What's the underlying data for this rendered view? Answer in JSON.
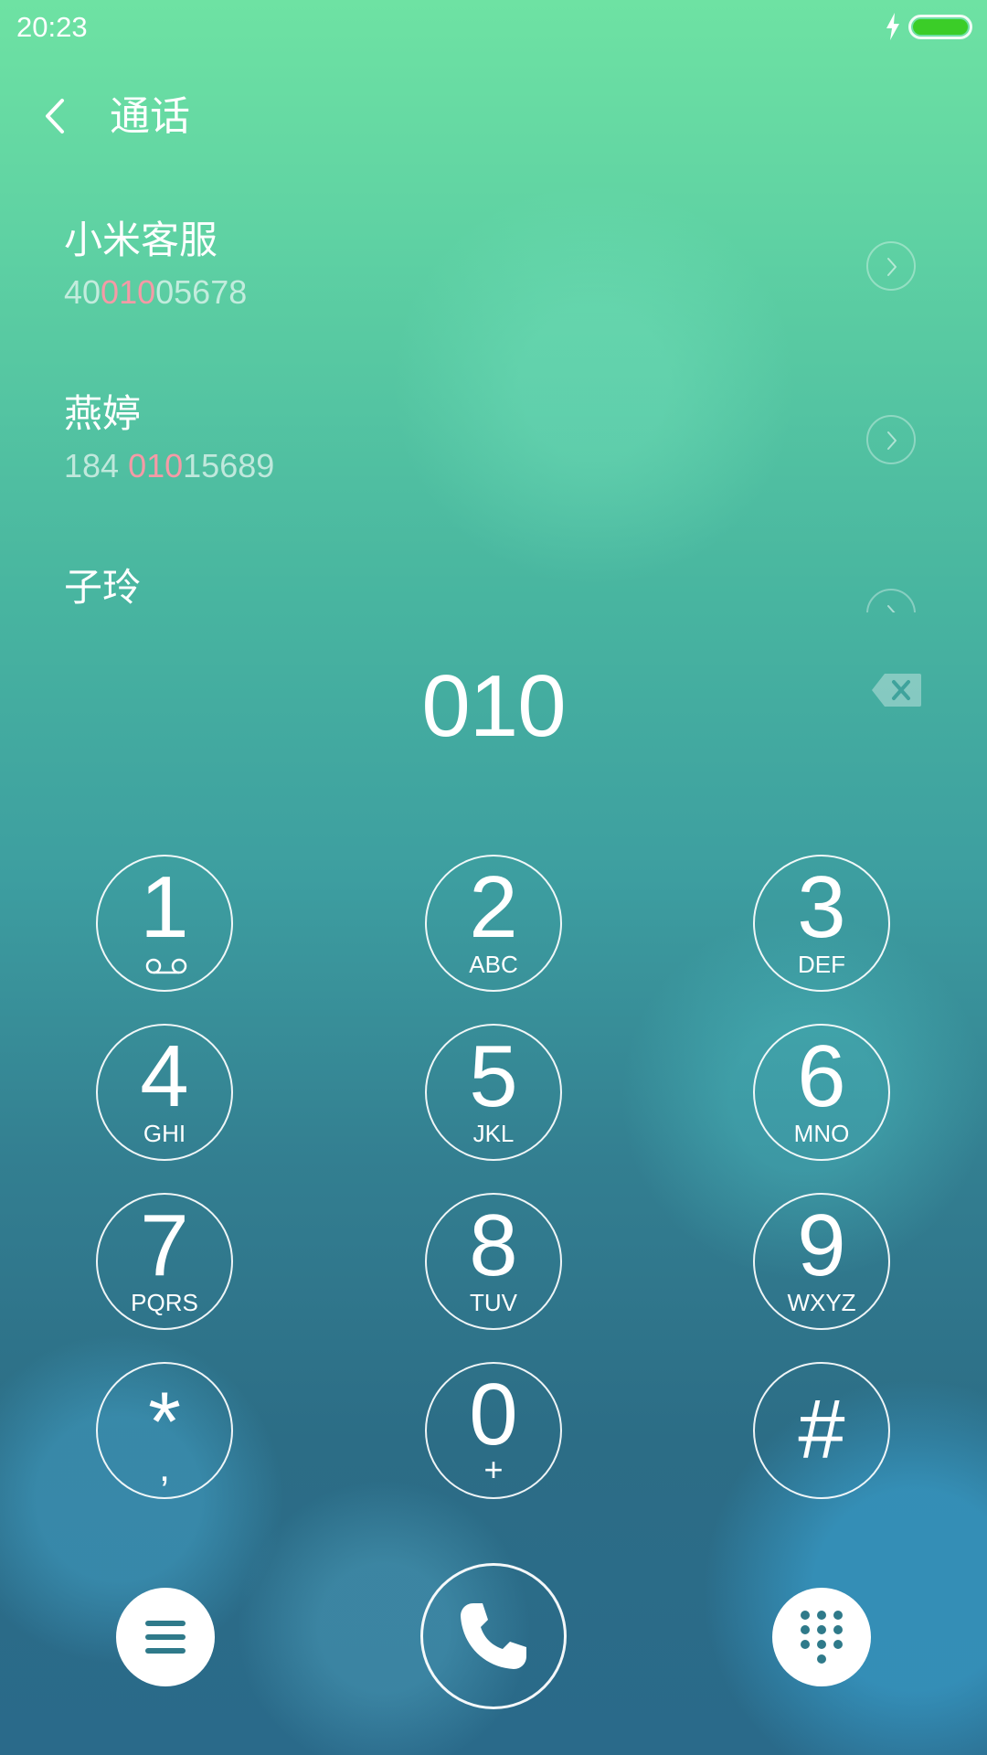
{
  "status_bar": {
    "time": "20:23",
    "battery_icon": "battery-full-charging-icon",
    "battery_color": "#3bcd28"
  },
  "header": {
    "back_icon": "chevron-left-icon",
    "title": "通话"
  },
  "results": [
    {
      "name": "小米客服",
      "number": {
        "before": "40",
        "match": "010",
        "after": "05678"
      }
    },
    {
      "name": "燕婷",
      "number": {
        "before": "184 ",
        "match": "010",
        "after": "15689"
      }
    },
    {
      "name": "子玲"
    }
  ],
  "highlight_color": "#f59aa6",
  "dialed": {
    "number": "010",
    "backspace_icon": "backspace-icon"
  },
  "keypad": [
    {
      "digit": "1",
      "sub_icon": "voicemail-icon"
    },
    {
      "digit": "2",
      "letters": "ABC"
    },
    {
      "digit": "3",
      "letters": "DEF"
    },
    {
      "digit": "4",
      "letters": "GHI"
    },
    {
      "digit": "5",
      "letters": "JKL"
    },
    {
      "digit": "6",
      "letters": "MNO"
    },
    {
      "digit": "7",
      "letters": "PQRS"
    },
    {
      "digit": "8",
      "letters": "TUV"
    },
    {
      "digit": "9",
      "letters": "WXYZ"
    },
    {
      "digit": "*",
      "letters": ","
    },
    {
      "digit": "0",
      "letters": "+"
    },
    {
      "digit": "#"
    }
  ],
  "bottom_bar": {
    "menu_icon": "menu-icon",
    "call_icon": "phone-icon",
    "dialpad_icon": "dialpad-icon"
  }
}
